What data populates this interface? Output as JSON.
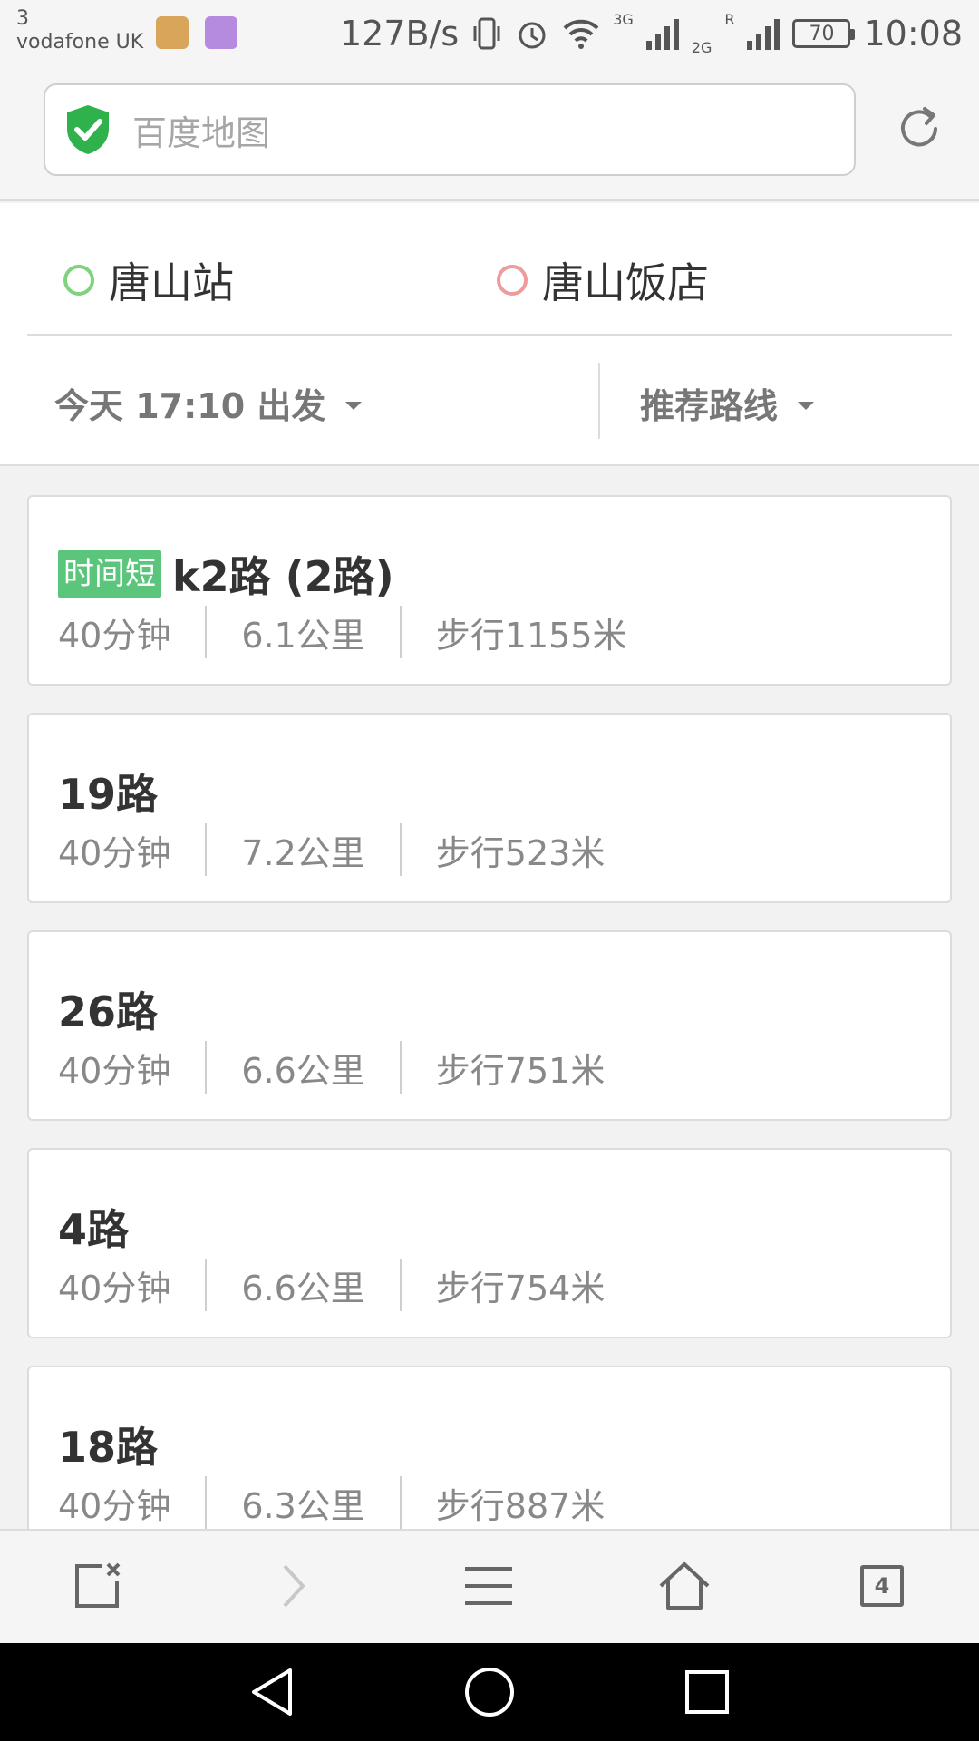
{
  "status_bar": {
    "carrier_line1": "3",
    "carrier_line2": "vodafone UK",
    "net_speed": "127B/s",
    "network_3g": "3G",
    "network_2g": "2G",
    "roaming": "R",
    "battery": "70",
    "time": "10:08"
  },
  "address_bar": {
    "placeholder": "百度地图"
  },
  "route_header": {
    "start": "唐山站",
    "end": "唐山饭店",
    "depart_option": "今天 17:10 出发",
    "route_option": "推荐路线"
  },
  "routes": [
    {
      "badge": "时间短",
      "name": "k2路 (2路)",
      "duration": "40分钟",
      "distance": "6.1公里",
      "walk": "步行1155米"
    },
    {
      "badge": "",
      "name": "19路",
      "duration": "40分钟",
      "distance": "7.2公里",
      "walk": "步行523米"
    },
    {
      "badge": "",
      "name": "26路",
      "duration": "40分钟",
      "distance": "6.6公里",
      "walk": "步行751米"
    },
    {
      "badge": "",
      "name": "4路",
      "duration": "40分钟",
      "distance": "6.6公里",
      "walk": "步行754米"
    },
    {
      "badge": "",
      "name": "18路",
      "duration": "40分钟",
      "distance": "6.3公里",
      "walk": "步行887米"
    }
  ],
  "browser_bar": {
    "tab_count": "4"
  },
  "colors": {
    "accent_green": "#5ac57b",
    "start_dot": "#7fd37f",
    "end_dot": "#ee9b9b",
    "shield": "#2fb24c"
  },
  "icons": [
    "shield-check-icon",
    "refresh-icon",
    "close-tab-icon",
    "forward-icon",
    "menu-icon",
    "home-icon",
    "tabs-icon",
    "back-nav-icon",
    "home-nav-icon",
    "recents-nav-icon"
  ]
}
